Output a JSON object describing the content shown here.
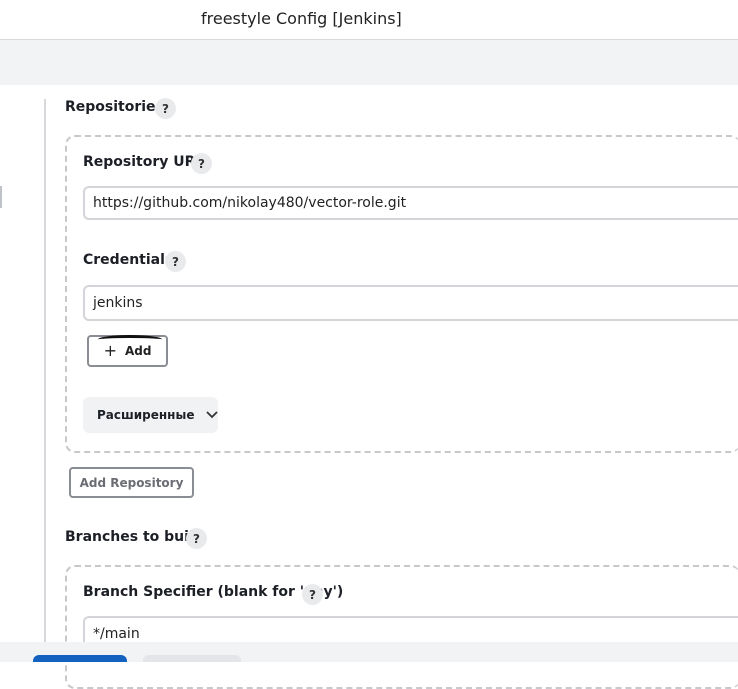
{
  "window": {
    "title": "freestyle Config [Jenkins]"
  },
  "repositories": {
    "label": "Repositories",
    "help": "?",
    "repository_url": {
      "label": "Repository URL",
      "help": "?",
      "value": "https://github.com/nikolay480/vector-role.git"
    },
    "credentials": {
      "label": "Credentials",
      "help": "?",
      "value": "jenkins",
      "add_icon": "plus-icon",
      "add_label": "Add"
    },
    "advanced": {
      "label": "Расширенные",
      "icon": "chevron-down-icon"
    },
    "add_repository_label": "Add Repository"
  },
  "branches": {
    "label": "Branches to build",
    "help": "?",
    "specifier": {
      "label": "Branch Specifier (blank for 'any')",
      "help": "?",
      "value": "*/main"
    }
  },
  "colors": {
    "primary_button": "#1462c0",
    "secondary_button": "#e4e5e8",
    "border": "#d3d5d9"
  }
}
